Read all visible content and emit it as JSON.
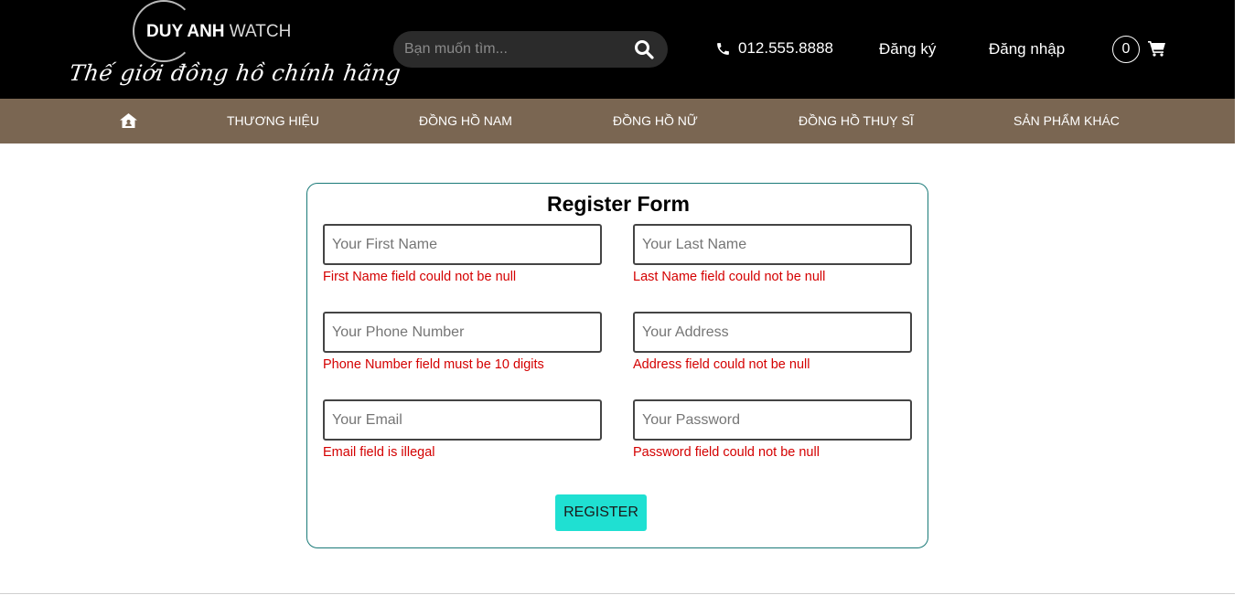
{
  "header": {
    "brand_bold": "DUY ANH",
    "brand_light": "WATCH",
    "tagline": "Thế giới đồng hồ chính hãng",
    "search": {
      "placeholder": "Bạn muốn tìm..."
    },
    "phone": "012.555.8888",
    "register_link": "Đăng ký",
    "login_link": "Đăng nhập",
    "cart_count": "0",
    "icons": {
      "search": "search-icon",
      "phone": "phone-icon",
      "cart": "cart-icon",
      "home": "home-icon"
    }
  },
  "menu": {
    "items": [
      "THƯƠNG HIỆU",
      "ĐỒNG HỒ NAM",
      "ĐỒNG HỒ NỮ",
      "ĐỒNG HỒ THUỴ SĨ",
      "SẢN PHẨM KHÁC"
    ]
  },
  "form": {
    "title": "Register Form",
    "fields": {
      "first_name": {
        "placeholder": "Your First Name",
        "value": "",
        "error": "First Name field could not be null"
      },
      "last_name": {
        "placeholder": "Your Last Name",
        "value": "",
        "error": "Last Name field could not be null"
      },
      "phone": {
        "placeholder": "Your Phone Number",
        "value": "",
        "error": "Phone Number field must be 10 digits"
      },
      "address": {
        "placeholder": "Your Address",
        "value": "",
        "error": "Address field could not be null"
      },
      "email": {
        "placeholder": "Your Email",
        "value": "",
        "error": "Email field is illegal"
      },
      "password": {
        "placeholder": "Your Password",
        "value": "",
        "error": "Password field could not be null"
      }
    },
    "submit_label": "REGISTER"
  },
  "colors": {
    "header_bg": "#000000",
    "menu_bg": "#7a6652",
    "form_border": "#1a7a78",
    "error": "#d40000",
    "button_bg": "#1fe0d2"
  }
}
